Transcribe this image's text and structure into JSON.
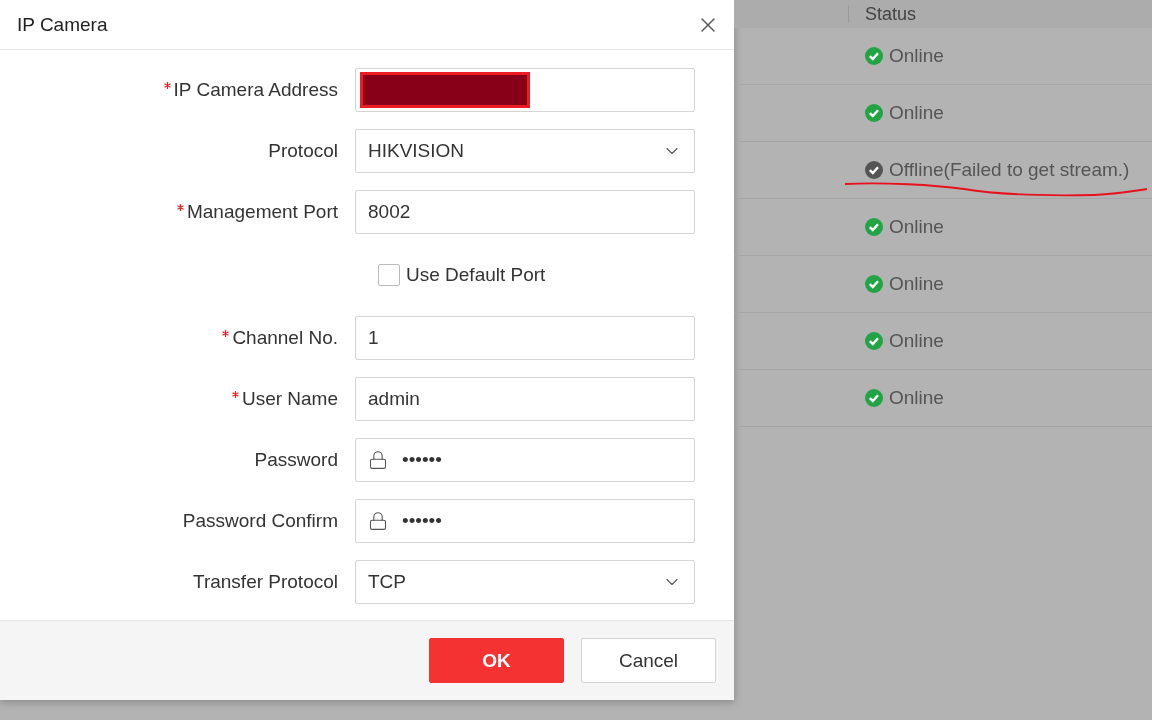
{
  "dialog": {
    "title": "IP Camera",
    "fields": [
      {
        "kind": "redacted",
        "label": "IP Camera Address",
        "required": true
      },
      {
        "kind": "select",
        "label": "Protocol",
        "required": false,
        "value": "HIKVISION"
      },
      {
        "kind": "text",
        "label": "Management Port",
        "required": true,
        "value": "8002"
      },
      {
        "kind": "checkbox",
        "label": "Use Default Port",
        "checked": false
      },
      {
        "kind": "text",
        "label": "Channel No.",
        "required": true,
        "value": "1"
      },
      {
        "kind": "text",
        "label": "User Name",
        "required": true,
        "value": "admin"
      },
      {
        "kind": "password",
        "label": "Password",
        "required": false,
        "value": "••••••"
      },
      {
        "kind": "password",
        "label": "Password Confirm",
        "required": false,
        "value": "••••••"
      },
      {
        "kind": "select",
        "label": "Transfer Protocol",
        "required": false,
        "value": "TCP"
      }
    ],
    "buttons": [
      {
        "kind": "primary",
        "label": "OK"
      },
      {
        "kind": "secondary",
        "label": "Cancel"
      }
    ]
  },
  "table": {
    "columns": [
      "Status"
    ],
    "rows": [
      {
        "kind": "online",
        "status": "Online",
        "underlined": false
      },
      {
        "kind": "online",
        "status": "Online",
        "underlined": false
      },
      {
        "kind": "offline",
        "status": "Offline(Failed to get stream.)",
        "underlined": true
      },
      {
        "kind": "online",
        "status": "Online",
        "underlined": false
      },
      {
        "kind": "online",
        "status": "Online",
        "underlined": false
      },
      {
        "kind": "online",
        "status": "Online",
        "underlined": false
      },
      {
        "kind": "online",
        "status": "Online",
        "underlined": false
      }
    ]
  }
}
